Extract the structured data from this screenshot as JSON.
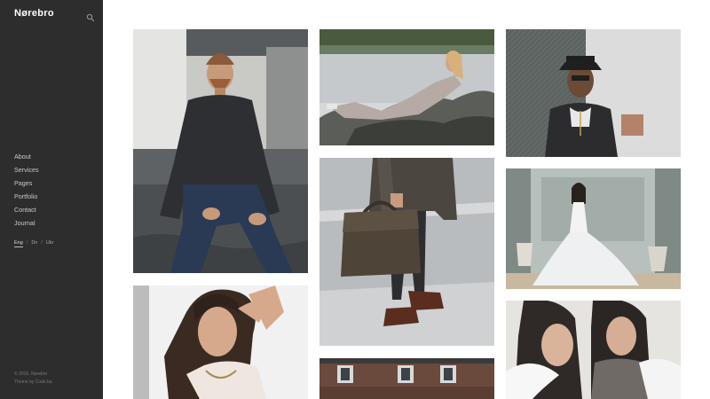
{
  "site": {
    "logo_text": "Nørebro"
  },
  "sidebar": {
    "nav_items": [
      {
        "label": "About"
      },
      {
        "label": "Services"
      },
      {
        "label": "Pages"
      },
      {
        "label": "Portfolio"
      },
      {
        "label": "Contact"
      },
      {
        "label": "Journal"
      }
    ],
    "languages": [
      {
        "label": "Eng",
        "active": true
      },
      {
        "label": "Dn",
        "active": false
      },
      {
        "label": "Ukr",
        "active": false
      }
    ],
    "language_separator": "/",
    "footer": {
      "copyright": "© 2016, Nørebro",
      "credit": "Theme by Code.ba"
    }
  },
  "icons": {
    "search": "search-icon"
  },
  "gallery": {
    "tiles": [
      {
        "subject": "bearded man in dark sweater seated on stone bench"
      },
      {
        "subject": "woman with long hair and hand in hair"
      },
      {
        "subject": "woman reclining on rocks by lake"
      },
      {
        "subject": "man holding woven leather briefcase on street"
      },
      {
        "subject": "brick building facade with white windows"
      },
      {
        "subject": "man in black hat and glasses with necklace"
      },
      {
        "subject": "bride in white mermaid gown in ornate room"
      },
      {
        "subject": "two women with dark hair and fur collar"
      }
    ]
  },
  "colors": {
    "sidebar_bg": "#2d2d2d",
    "page_bg": "#ffffff",
    "nav_text": "#c9c9c9"
  }
}
